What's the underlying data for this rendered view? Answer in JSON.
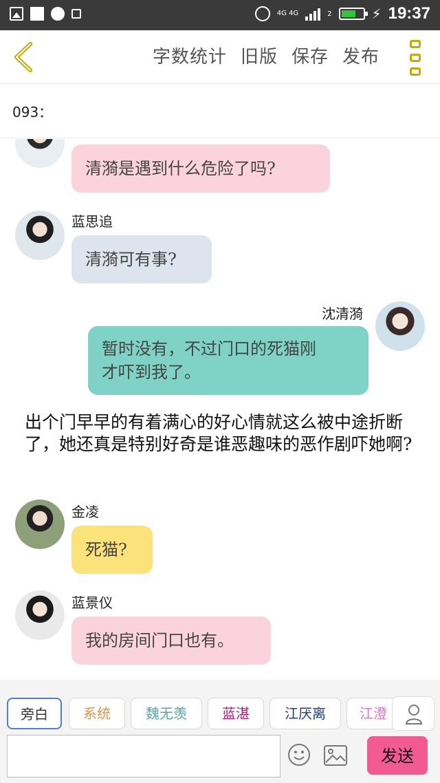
{
  "status_bar": {
    "time": "19:37",
    "network": "4G 4G",
    "sim_slot": "2"
  },
  "header": {
    "actions": [
      "字数统计",
      "旧版",
      "保存",
      "发布"
    ],
    "accent": "#c9a900"
  },
  "chapter": {
    "label": "093："
  },
  "messages": [
    {
      "speaker": "",
      "text": "清漪是遇到什么危险了吗?",
      "color": "#fbd3dc"
    },
    {
      "speaker": "蓝思追",
      "text": "清漪可有事?",
      "color": "#dee4ee"
    },
    {
      "speaker": "沈清漪",
      "text_line1": "暂时没有，不过门口的死猫刚",
      "text_line2": "才吓到我了。",
      "color": "#7fd3c6"
    },
    {
      "speaker": "金凌",
      "text": "死猫?",
      "color": "#fce27a"
    },
    {
      "speaker": "蓝景仪",
      "text": "我的房间门口也有。",
      "color": "#fbd3dc"
    }
  ],
  "narration": "出个门早早的有着满心的好心情就这么被中途折断了，她还真是特别好奇是谁恶趣味的恶作剧吓她啊?",
  "roles": [
    {
      "label": "旁白",
      "color": "#333333"
    },
    {
      "label": "系统",
      "color": "#e8924a"
    },
    {
      "label": "魏无羡",
      "color": "#5aa6a6"
    },
    {
      "label": "蓝湛",
      "color": "#b0207a"
    },
    {
      "label": "江厌离",
      "color": "#1c3f8a"
    },
    {
      "label": "江澄",
      "color": "#e36fd6"
    }
  ],
  "input": {
    "placeholder": "",
    "send_label": "发送",
    "send_color": "#f25b91"
  }
}
